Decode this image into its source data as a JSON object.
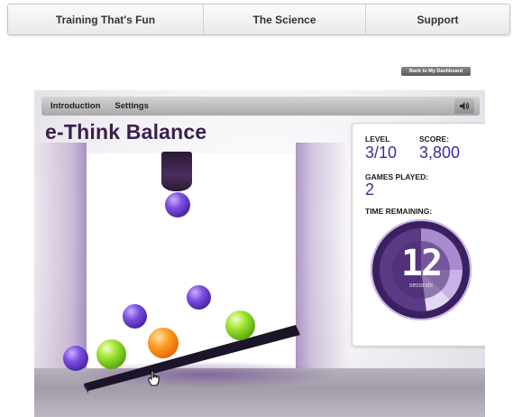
{
  "nav": {
    "items": [
      {
        "label": "Training That's Fun"
      },
      {
        "label": "The Science"
      },
      {
        "label": "Support"
      }
    ]
  },
  "back_button": {
    "label": "Back to My Dashboard"
  },
  "game": {
    "toolbar": {
      "introduction": "Introduction",
      "settings": "Settings",
      "sound_icon": "speaker-icon"
    },
    "title": "e-Think Balance",
    "stats": {
      "level_label": "LEVEL",
      "level_value": "3/10",
      "score_label": "SCORE:",
      "score_value": "3,800",
      "games_played_label": "GAMES PLAYED:",
      "games_played_value": "2",
      "time_label": "TIME REMAINING:",
      "time_value": "12",
      "time_unit": "seconds"
    },
    "colors": {
      "purple_ball": "#6a3fd0",
      "green_ball": "#8cd41f",
      "orange_ball": "#ff8c1a",
      "accent": "#3a2ea0"
    }
  }
}
